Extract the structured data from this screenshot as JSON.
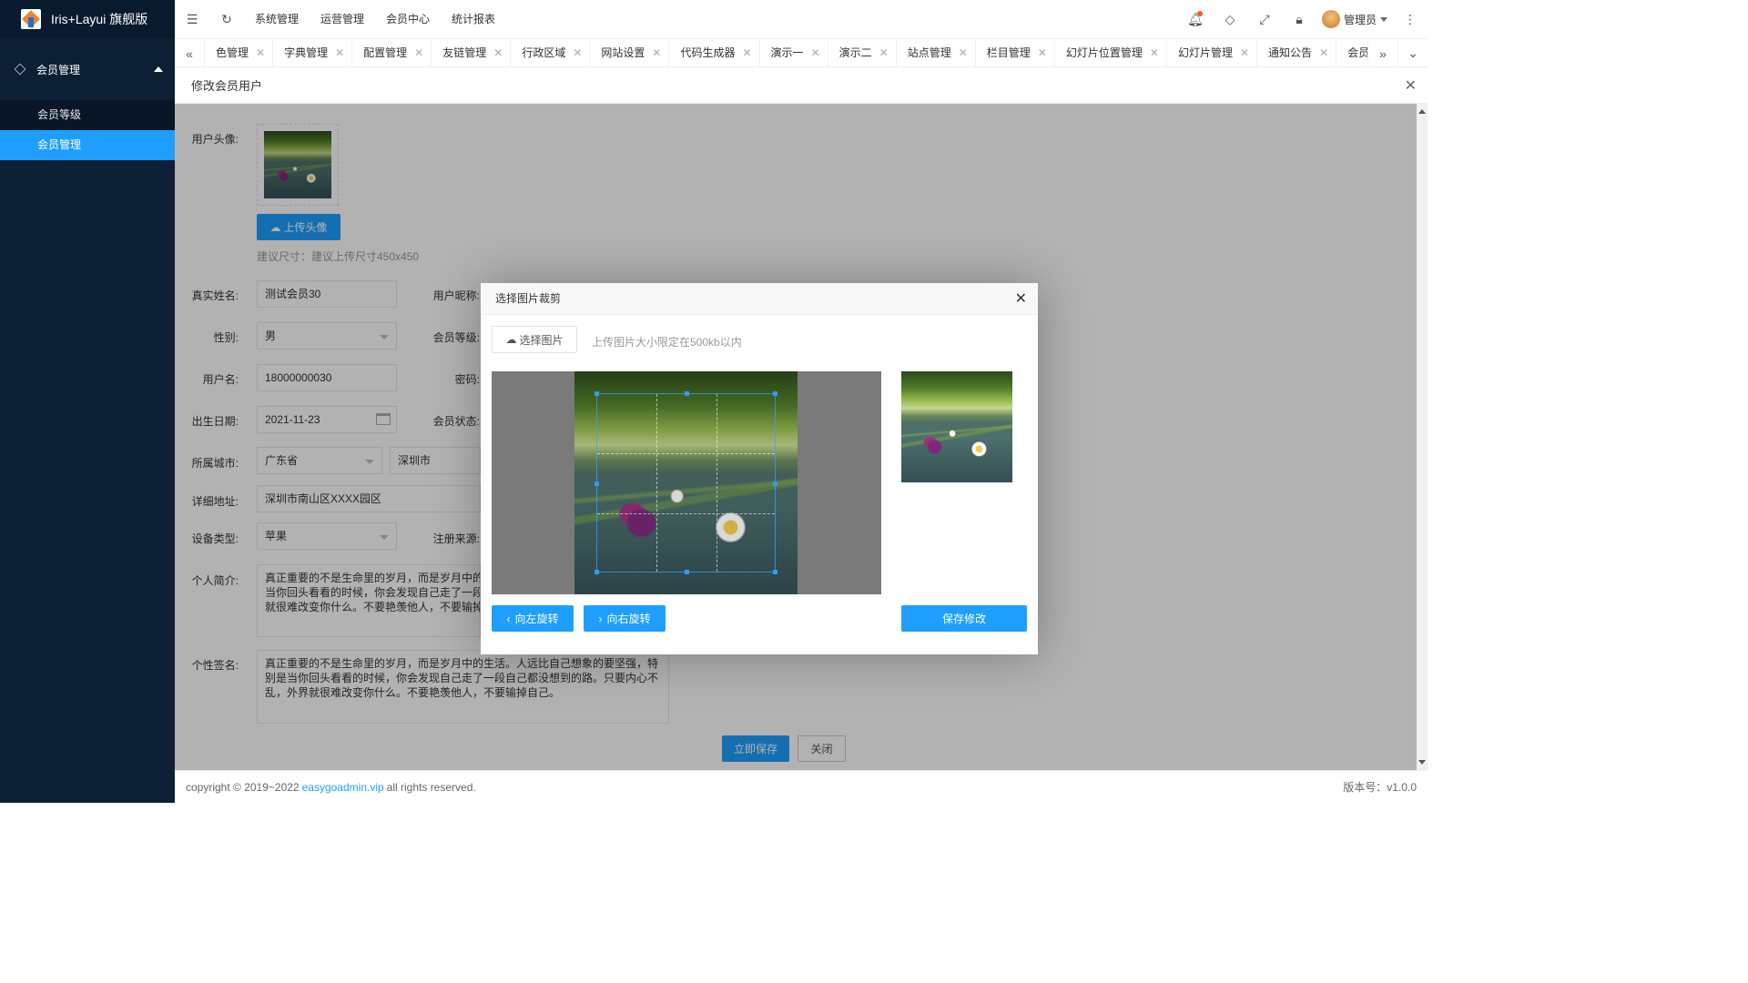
{
  "app": {
    "title": "Iris+Layui 旗舰版"
  },
  "sidebar": {
    "group_label": "会员管理",
    "items": [
      {
        "label": "会员等级",
        "active": false
      },
      {
        "label": "会员管理",
        "active": true
      }
    ]
  },
  "header": {
    "menus": [
      "系统管理",
      "运营管理",
      "会员中心",
      "统计报表"
    ],
    "user": "管理员",
    "icons": [
      "menu-fold-icon",
      "refresh-icon",
      "bell-icon",
      "tag-icon",
      "fullscreen-icon",
      "lock-icon",
      "more-vertical-icon"
    ]
  },
  "tabs": [
    "色管理",
    "字典管理",
    "配置管理",
    "友链管理",
    "行政区域",
    "网站设置",
    "代码生成器",
    "演示一",
    "演示二",
    "站点管理",
    "栏目管理",
    "幻灯片位置管理",
    "幻灯片管理",
    "通知公告",
    "会员等级",
    "会"
  ],
  "page": {
    "title": "修改会员用户",
    "form": {
      "avatar_label": "用户头像:",
      "upload_button": "上传头像",
      "avatar_hint": "建议尺寸：建议上传尺寸450x450",
      "realname_label": "真实姓名:",
      "realname_value": "测试会员30",
      "nickname_label": "用户昵称:",
      "gender_label": "性别:",
      "gender_value": "男",
      "level_label": "会员等级:",
      "username_label": "用户名:",
      "username_value": "18000000030",
      "password_label": "密码:",
      "birthday_label": "出生日期:",
      "birthday_value": "2021-11-23",
      "status_label": "会员状态:",
      "city_label": "所属城市:",
      "province_value": "广东省",
      "city_value": "深圳市",
      "address_label": "详细地址:",
      "address_value": "深圳市南山区XXXX园区",
      "device_label": "设备类型:",
      "device_value": "苹果",
      "source_label": "注册来源:",
      "intro_label": "个人简介:",
      "intro_value": "真正重要的不是生命里的岁月，而是岁月中的生\n当你回头看看的时候，你会发现自己走了一段自\n就很难改变你什么。不要艳羡他人，不要输掉自",
      "sign_label": "个性签名:",
      "sign_value": "真正重要的不是生命里的岁月，而是岁月中的生活。人远比自己想象的要坚强，特别是当你回头看看的时候，你会发现自己走了一段自己都没想到的路。只要内心不乱，外界就很难改变你什么。不要艳羡他人，不要输掉自己。",
      "save_button": "立即保存",
      "close_button": "关闭"
    }
  },
  "modal": {
    "title": "选择图片裁剪",
    "choose_button": "选择图片",
    "hint": "上传图片大小限定在500kb以内",
    "rotate_left": "向左旋转",
    "rotate_right": "向右旋转",
    "save": "保存修改"
  },
  "footer": {
    "copyright_prefix": "copyright © 2019~2022",
    "link": "easygoadmin.vip",
    "suffix": "all rights reserved.",
    "version": "版本号：v1.0.0"
  },
  "colors": {
    "primary": "#1e9fff",
    "sidebar": "#0c1f35"
  }
}
